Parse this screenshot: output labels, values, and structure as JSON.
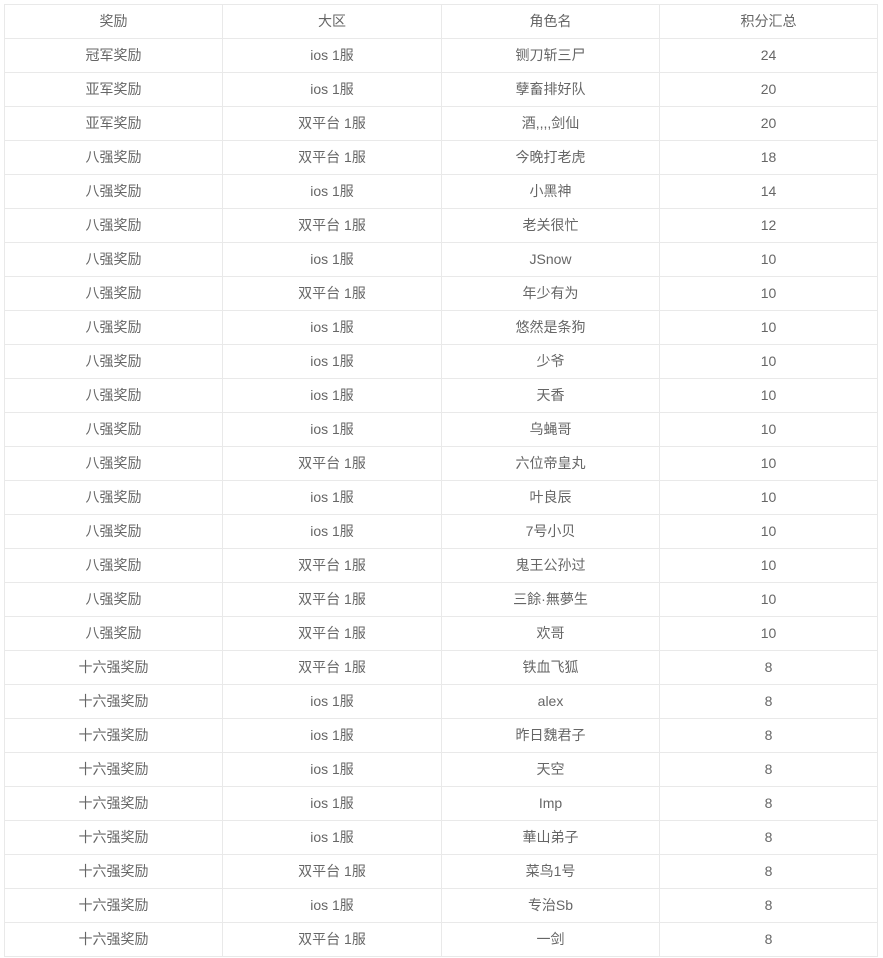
{
  "table": {
    "columns": [
      {
        "key": "award",
        "label": "奖励"
      },
      {
        "key": "region",
        "label": "大区"
      },
      {
        "key": "name",
        "label": "角色名"
      },
      {
        "key": "score",
        "label": "积分汇总"
      }
    ],
    "rows": [
      {
        "award": "冠军奖励",
        "region": "ios 1服",
        "name": "铡刀斩三尸",
        "score": "24"
      },
      {
        "award": "亚军奖励",
        "region": "ios 1服",
        "name": "孽畜排好队",
        "score": "20"
      },
      {
        "award": "亚军奖励",
        "region": "双平台 1服",
        "name": "酒,,,,剑仙",
        "score": "20"
      },
      {
        "award": "八强奖励",
        "region": "双平台 1服",
        "name": "今晚打老虎",
        "score": "18"
      },
      {
        "award": "八强奖励",
        "region": "ios 1服",
        "name": "小黑神",
        "score": "14"
      },
      {
        "award": "八强奖励",
        "region": "双平台 1服",
        "name": "老关很忙",
        "score": "12"
      },
      {
        "award": "八强奖励",
        "region": "ios 1服",
        "name": "JSnow",
        "score": "10"
      },
      {
        "award": "八强奖励",
        "region": "双平台 1服",
        "name": "年少有为",
        "score": "10"
      },
      {
        "award": "八强奖励",
        "region": "ios 1服",
        "name": "悠然是条狗",
        "score": "10"
      },
      {
        "award": "八强奖励",
        "region": "ios 1服",
        "name": "少爷",
        "score": "10"
      },
      {
        "award": "八强奖励",
        "region": "ios 1服",
        "name": "天香",
        "score": "10"
      },
      {
        "award": "八强奖励",
        "region": "ios 1服",
        "name": "乌蝇哥",
        "score": "10"
      },
      {
        "award": "八强奖励",
        "region": "双平台 1服",
        "name": "六位帝皇丸",
        "score": "10"
      },
      {
        "award": "八强奖励",
        "region": "ios 1服",
        "name": "叶良辰",
        "score": "10"
      },
      {
        "award": "八强奖励",
        "region": "ios 1服",
        "name": "7号小贝",
        "score": "10"
      },
      {
        "award": "八强奖励",
        "region": "双平台 1服",
        "name": "鬼王公孙过",
        "score": "10"
      },
      {
        "award": "八强奖励",
        "region": "双平台 1服",
        "name": "三餘·無夢生",
        "score": "10"
      },
      {
        "award": "八强奖励",
        "region": "双平台 1服",
        "name": "欢哥",
        "score": "10"
      },
      {
        "award": "十六强奖励",
        "region": "双平台 1服",
        "name": "铁血飞狐",
        "score": "8"
      },
      {
        "award": "十六强奖励",
        "region": "ios 1服",
        "name": "alex",
        "score": "8"
      },
      {
        "award": "十六强奖励",
        "region": "ios 1服",
        "name": "昨日魏君子",
        "score": "8"
      },
      {
        "award": "十六强奖励",
        "region": "ios 1服",
        "name": "天空",
        "score": "8"
      },
      {
        "award": "十六强奖励",
        "region": "ios 1服",
        "name": "Imp",
        "score": "8"
      },
      {
        "award": "十六强奖励",
        "region": "ios 1服",
        "name": "華山弟子",
        "score": "8"
      },
      {
        "award": "十六强奖励",
        "region": "双平台 1服",
        "name": "菜鸟1号",
        "score": "8"
      },
      {
        "award": "十六强奖励",
        "region": "ios 1服",
        "name": "专治Sb",
        "score": "8"
      },
      {
        "award": "十六强奖励",
        "region": "双平台 1服",
        "name": "一剑",
        "score": "8"
      }
    ]
  },
  "style": {
    "border_color": "#e9e9e9",
    "text_color": "#666666",
    "background": "#ffffff"
  }
}
